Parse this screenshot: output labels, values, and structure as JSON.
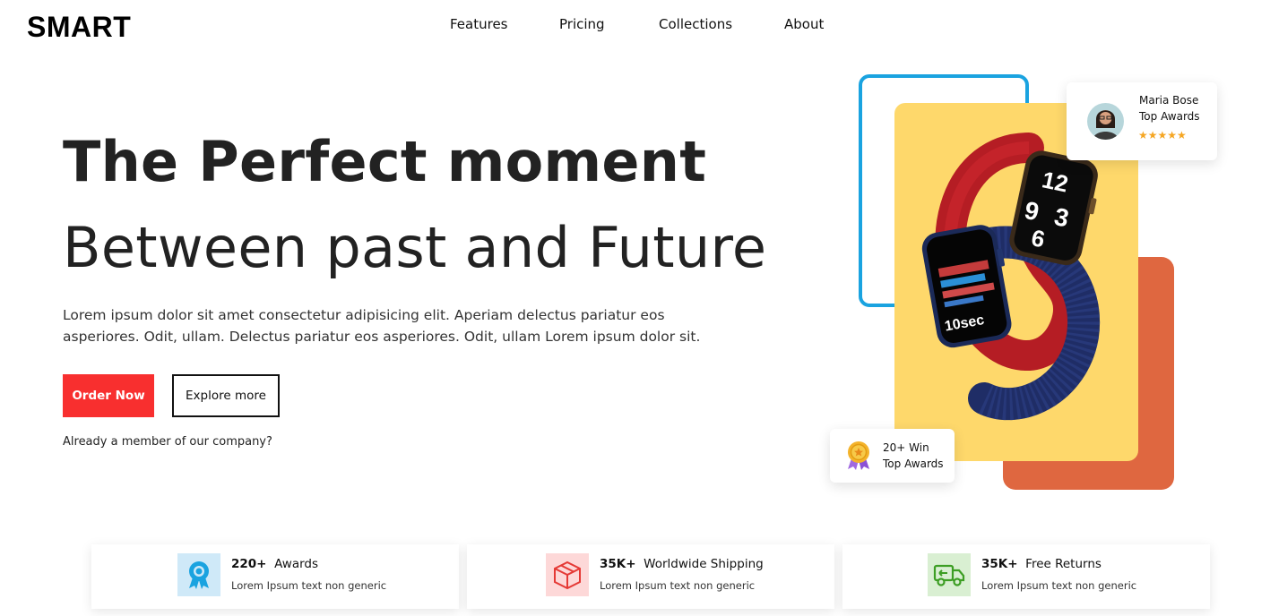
{
  "brand": {
    "logo": "SMART"
  },
  "nav": {
    "items": [
      "Features",
      "Pricing",
      "Collections",
      "About"
    ]
  },
  "hero": {
    "title_line1": "The Perfect moment",
    "title_line2": "Between past and Future",
    "description": "Lorem ipsum dolor sit amet consectetur adipisicing elit. Aperiam delectus pariatur eos asperiores. Odit, ullam. Delectus pariatur eos asperiores. Odit, ullam Lorem ipsum dolor sit.",
    "order_button": "Order Now",
    "explore_button": "Explore more",
    "member_text": "Already a member of our company?"
  },
  "review_card": {
    "name": "Maria Bose",
    "subtitle": "Top Awards",
    "stars": "★★★★★",
    "rating": 5
  },
  "award_card": {
    "line1": "20+ Win",
    "line2": "Top Awards"
  },
  "watch_screen": {
    "time": "10sec",
    "face_digits": "12 9 6 3"
  },
  "stats": [
    {
      "icon": "award-icon",
      "value": "220+",
      "label": "Awards",
      "sub": "Lorem Ipsum text non generic",
      "accent": "#1aa3e0",
      "bg": "#cfe9f8"
    },
    {
      "icon": "box-icon",
      "value": "35K+",
      "label": "Worldwide Shipping",
      "sub": "Lorem Ipsum text non generic",
      "accent": "#e53935",
      "bg": "#fdd8d8"
    },
    {
      "icon": "truck-return-icon",
      "value": "35K+",
      "label": "Free Returns",
      "sub": "Lorem Ipsum text non generic",
      "accent": "#3d9e24",
      "bg": "#d9efd2"
    }
  ],
  "colors": {
    "order_button": "#f82f2f",
    "blue_frame": "#1aa3e0",
    "yellow_card": "#fed86b",
    "orange_card": "#df6740",
    "stars": "#f5a623"
  }
}
